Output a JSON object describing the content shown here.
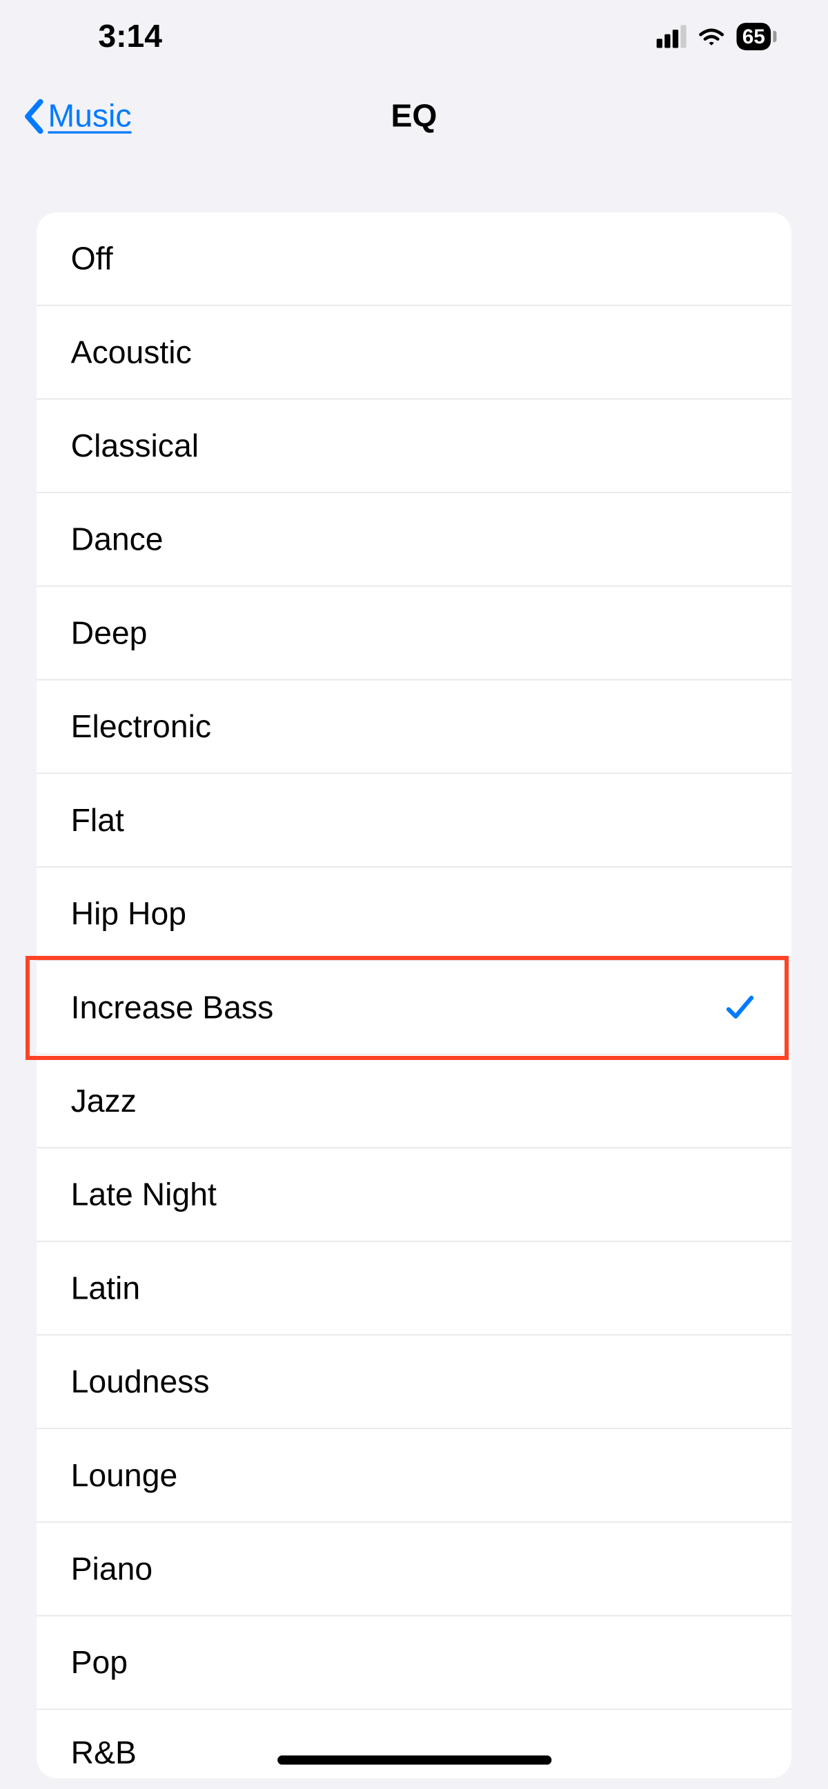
{
  "status": {
    "time": "3:14",
    "battery": "65"
  },
  "nav": {
    "back_label": "Music",
    "title": "EQ"
  },
  "eq_options": [
    {
      "label": "Off",
      "selected": false
    },
    {
      "label": "Acoustic",
      "selected": false
    },
    {
      "label": "Classical",
      "selected": false
    },
    {
      "label": "Dance",
      "selected": false
    },
    {
      "label": "Deep",
      "selected": false
    },
    {
      "label": "Electronic",
      "selected": false
    },
    {
      "label": "Flat",
      "selected": false
    },
    {
      "label": "Hip Hop",
      "selected": false
    },
    {
      "label": "Increase Bass",
      "selected": true,
      "highlighted": true
    },
    {
      "label": "Jazz",
      "selected": false
    },
    {
      "label": "Late Night",
      "selected": false
    },
    {
      "label": "Latin",
      "selected": false
    },
    {
      "label": "Loudness",
      "selected": false
    },
    {
      "label": "Lounge",
      "selected": false
    },
    {
      "label": "Piano",
      "selected": false
    },
    {
      "label": "Pop",
      "selected": false
    },
    {
      "label": "R&B",
      "selected": false
    }
  ],
  "colors": {
    "accent": "#007aff",
    "background": "#f2f2f7",
    "highlight_border": "#ff4326"
  }
}
